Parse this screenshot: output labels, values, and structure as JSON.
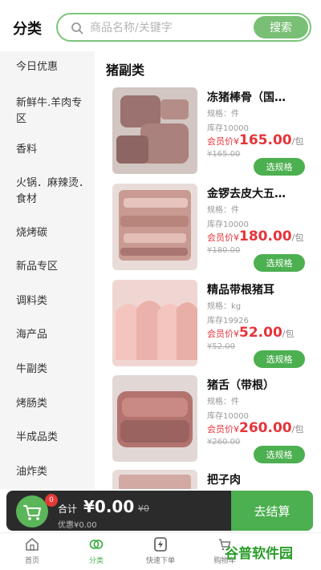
{
  "header": {
    "title": "分类",
    "search_placeholder": "商品名称/关键字",
    "search_button": "搜索"
  },
  "sidebar": {
    "items": [
      {
        "label": "今日优惠"
      },
      {
        "label": "新鲜牛.羊肉专区"
      },
      {
        "label": "香料"
      },
      {
        "label": "火锅．麻辣烫．食材"
      },
      {
        "label": "烧烤碳"
      },
      {
        "label": "新品专区"
      },
      {
        "label": "调料类"
      },
      {
        "label": "海产品"
      },
      {
        "label": "牛副类"
      },
      {
        "label": "烤肠类"
      },
      {
        "label": "半成品类"
      },
      {
        "label": "油炸类"
      }
    ]
  },
  "main": {
    "category_title": "猪副类",
    "products": [
      {
        "name": "冻猪棒骨（国…",
        "spec": "规格：件",
        "stock": "库存10000",
        "price_label": "会员价¥",
        "price": "165.00",
        "unit": "/包",
        "original_price": "¥165.00",
        "button": "选规格"
      },
      {
        "name": "金锣去皮大五…",
        "spec": "规格：件",
        "stock": "库存10000",
        "price_label": "会员价¥",
        "price": "180.00",
        "unit": "/包",
        "original_price": "¥180.00",
        "button": "选规格"
      },
      {
        "name": "精品带根猪耳",
        "spec": "规格：kg",
        "stock": "库存19926",
        "price_label": "会员价¥",
        "price": "52.00",
        "unit": "/包",
        "original_price": "¥52.00",
        "button": "选规格"
      },
      {
        "name": "猪舌（带根）",
        "spec": "规格：件",
        "stock": "库存10000",
        "price_label": "会员价¥",
        "price": "260.00",
        "unit": "/包",
        "original_price": "¥260.00",
        "button": "选规格"
      },
      {
        "name": "把子肉",
        "spec": "",
        "stock": "",
        "price_label": "",
        "price": "",
        "unit": "",
        "original_price": "",
        "button": ""
      }
    ]
  },
  "cart": {
    "badge": "0",
    "total_label": "合计",
    "total_value": "¥0.00",
    "original": "¥0",
    "discount": "优惠¥0.00",
    "checkout": "去结算"
  },
  "tabbar": {
    "tabs": [
      {
        "label": "首页"
      },
      {
        "label": "分类"
      },
      {
        "label": "快速下单"
      },
      {
        "label": "购物车"
      }
    ]
  },
  "watermark": "谷普软件园",
  "colors": {
    "accent": "#4caf50",
    "price": "#e5343a",
    "cart_bar": "#2b2b2b"
  }
}
